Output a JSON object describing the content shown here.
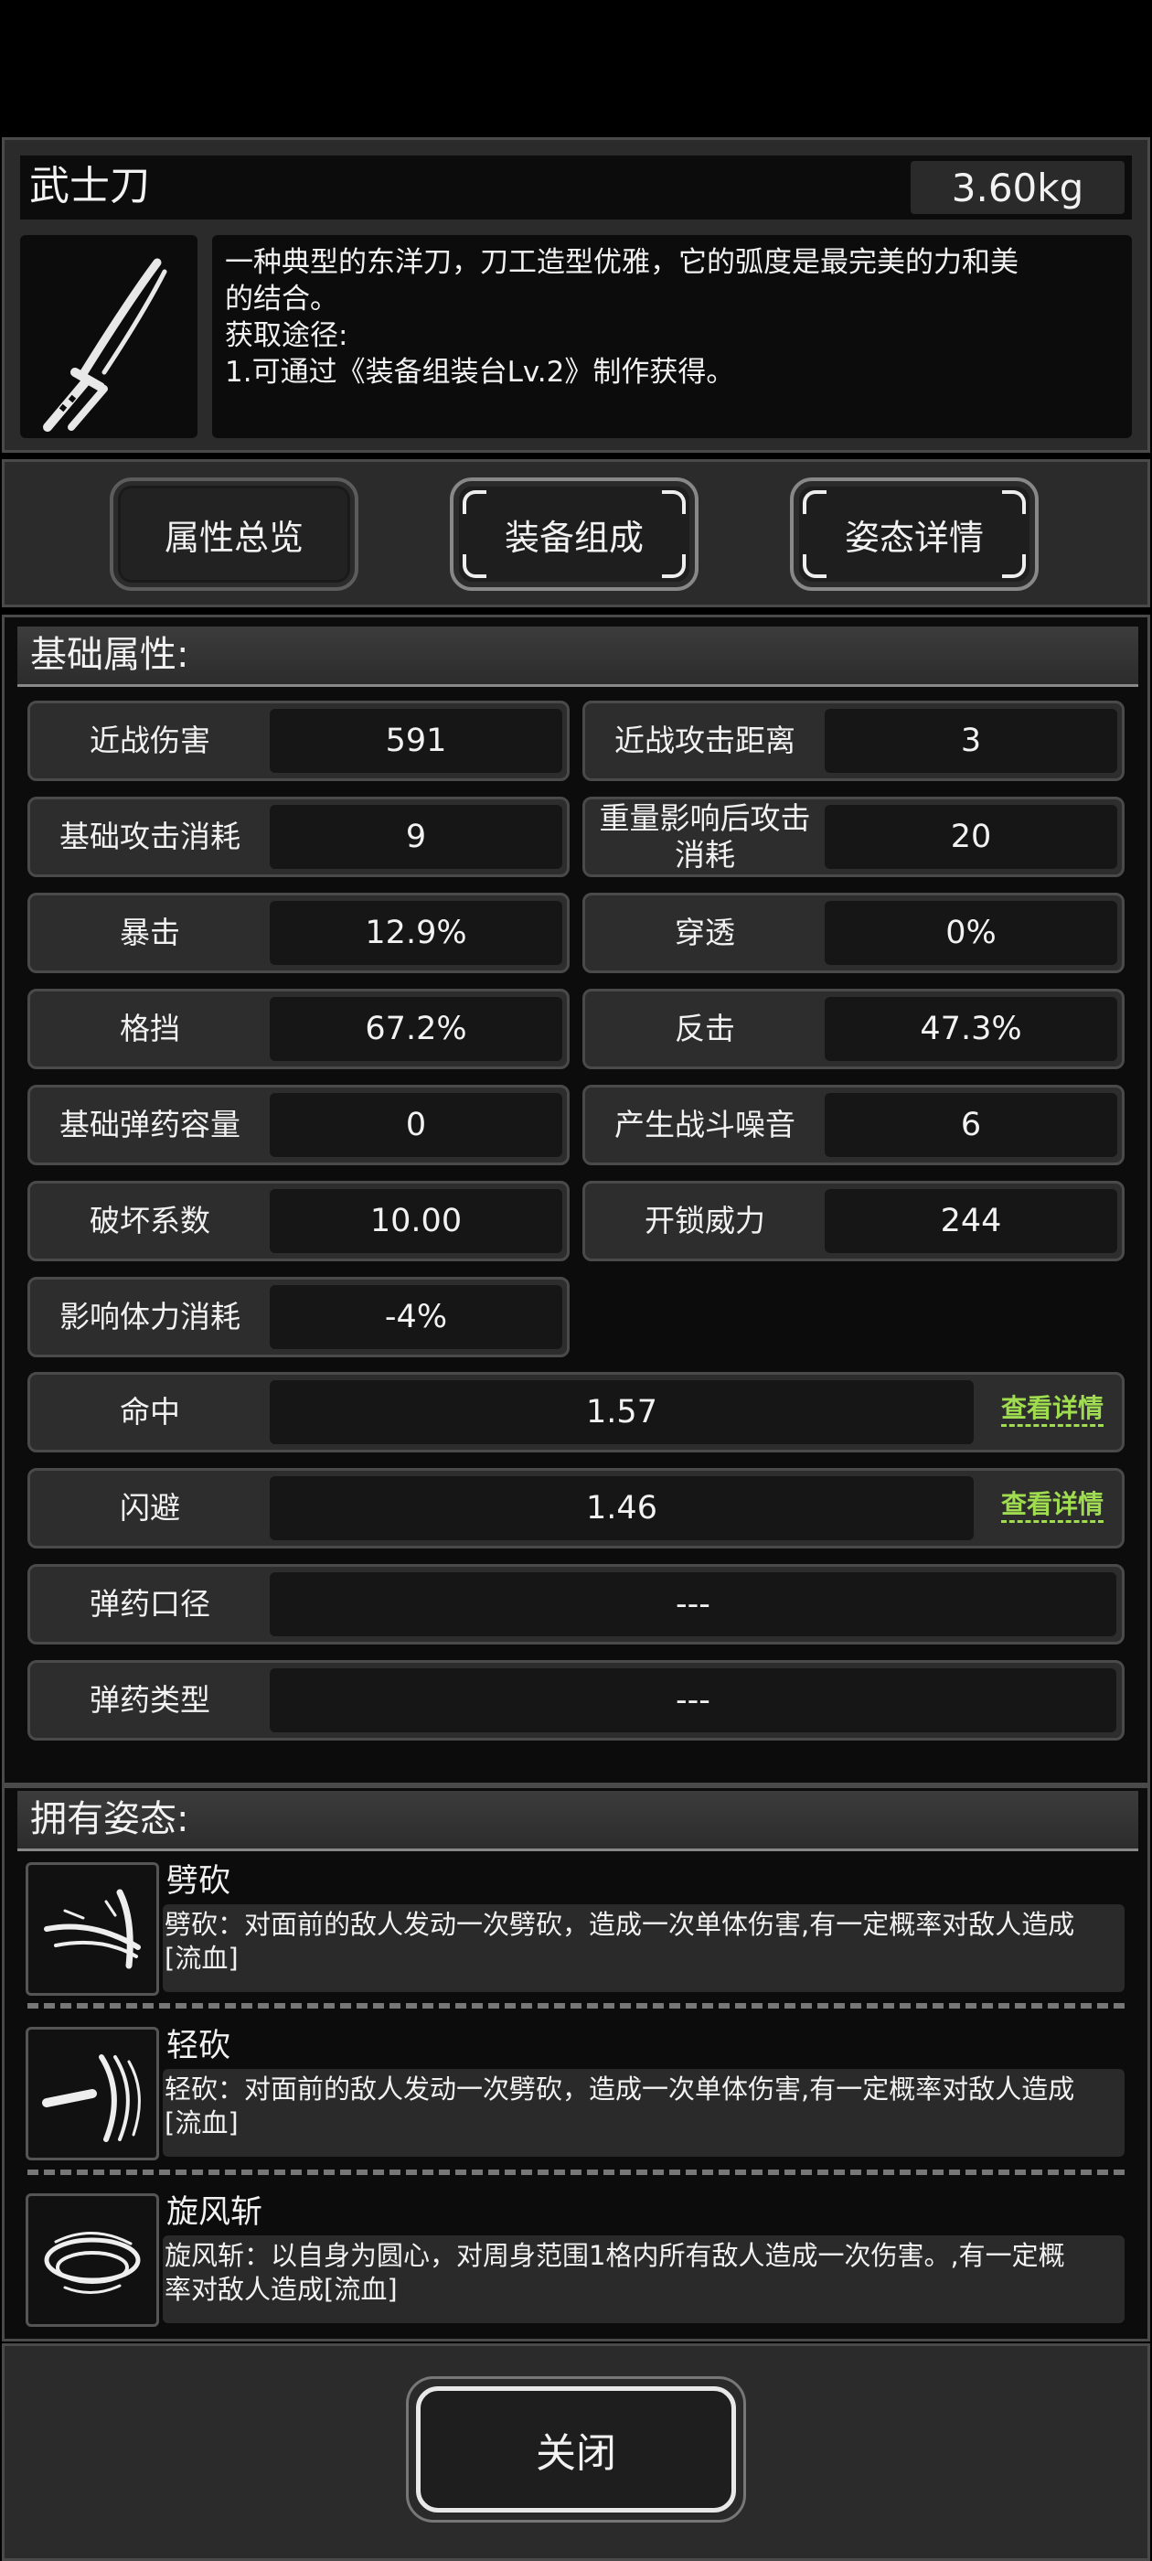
{
  "item": {
    "name": "武士刀",
    "weight": "3.60kg",
    "description_lines": [
      "一种典型的东洋刀，刀工造型优雅，它的弧度是最完美的力和美",
      "的结合。",
      "获取途径:",
      "1.可通过《装备组装台Lv.2》制作获得。"
    ],
    "icon": "katana-icon"
  },
  "tabs": [
    {
      "label": "属性总览",
      "active": true
    },
    {
      "label": "装备组成",
      "active": false
    },
    {
      "label": "姿态详情",
      "active": false
    }
  ],
  "attributes": {
    "heading": "基础属性:",
    "pairs": [
      [
        {
          "label": "近战伤害",
          "value": "591"
        },
        {
          "label": "近战攻击距离",
          "value": "3"
        }
      ],
      [
        {
          "label": "基础攻击消耗",
          "value": "9"
        },
        {
          "label": "重量影响后攻击消耗",
          "value": "20"
        }
      ],
      [
        {
          "label": "暴击",
          "value": "12.9%"
        },
        {
          "label": "穿透",
          "value": "0%"
        }
      ],
      [
        {
          "label": "格挡",
          "value": "67.2%"
        },
        {
          "label": "反击",
          "value": "47.3%"
        }
      ],
      [
        {
          "label": "基础弹药容量",
          "value": "0"
        },
        {
          "label": "产生战斗噪音",
          "value": "6"
        }
      ],
      [
        {
          "label": "破坏系数",
          "value": "10.00"
        },
        {
          "label": "开锁威力",
          "value": "244"
        }
      ],
      [
        {
          "label": "影响体力消耗",
          "value": "-4%"
        }
      ]
    ],
    "wide": [
      {
        "label": "命中",
        "value": "1.57",
        "link": "查看详情"
      },
      {
        "label": "闪避",
        "value": "1.46",
        "link": "查看详情"
      },
      {
        "label": "弹药口径",
        "value": "---"
      },
      {
        "label": "弹药类型",
        "value": "---"
      }
    ]
  },
  "postures": {
    "heading": "拥有姿态:",
    "items": [
      {
        "name": "劈砍",
        "desc_lines": [
          "劈砍：对面前的敌人发动一次劈砍，造成一次单体伤害,有一定概率对敌人造成",
          "[流血]"
        ],
        "icon": "slash-icon"
      },
      {
        "name": "轻砍",
        "desc_lines": [
          "轻砍：对面前的敌人发动一次劈砍，造成一次单体伤害,有一定概率对敌人造成",
          "[流血]"
        ],
        "icon": "light-slash-icon"
      },
      {
        "name": "旋风斩",
        "desc_lines": [
          "旋风斩：以自身为圆心，对周身范围1格内所有敌人造成一次伤害。,有一定概",
          "率对敌人造成[流血]"
        ],
        "icon": "whirlwind-icon"
      }
    ]
  },
  "footer": {
    "close_label": "关闭"
  },
  "colors": {
    "link": "#9fdc50",
    "panel": "#2b2b2b",
    "inset": "#0c0c0c"
  }
}
